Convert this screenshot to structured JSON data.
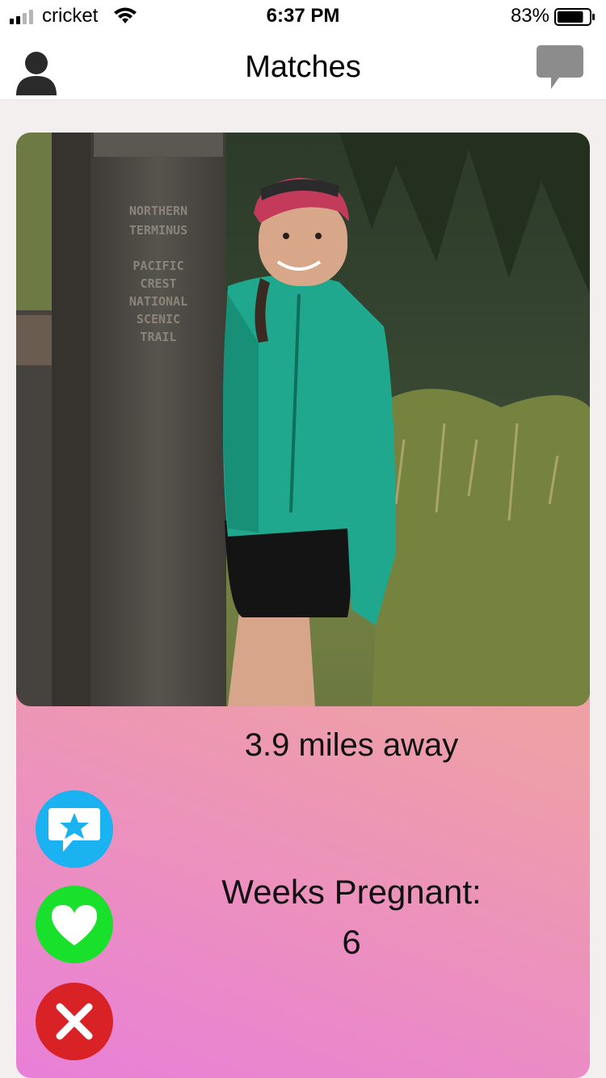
{
  "status_bar": {
    "carrier": "cricket",
    "time": "6:37 PM",
    "battery_percent": "83%",
    "battery_level": 0.83,
    "icons": [
      "signal-icon",
      "wifi-icon",
      "battery-icon"
    ]
  },
  "nav": {
    "title": "Matches",
    "left_icon": "profile-icon",
    "right_icon": "chat-bubble-icon"
  },
  "card": {
    "distance": "3.9 miles away",
    "weeks_label": "Weeks Pregnant:",
    "weeks_value": "6",
    "sign_text": [
      "NORTHERN",
      "TERMINUS",
      "PACIFIC",
      "CREST",
      "NATIONAL",
      "SCENIC",
      "TRAIL"
    ],
    "actions": [
      {
        "name": "superlike",
        "icon": "star-message-icon",
        "color": "#1ab2f0"
      },
      {
        "name": "like",
        "icon": "heart-icon",
        "color": "#19e02a"
      },
      {
        "name": "pass",
        "icon": "close-icon",
        "color": "#d82226"
      }
    ]
  },
  "colors": {
    "gradient_top": "#f6c95a",
    "gradient_mid": "#ee9fa8",
    "gradient_bottom": "#e97fd8",
    "jacket": "#1fa88e"
  }
}
